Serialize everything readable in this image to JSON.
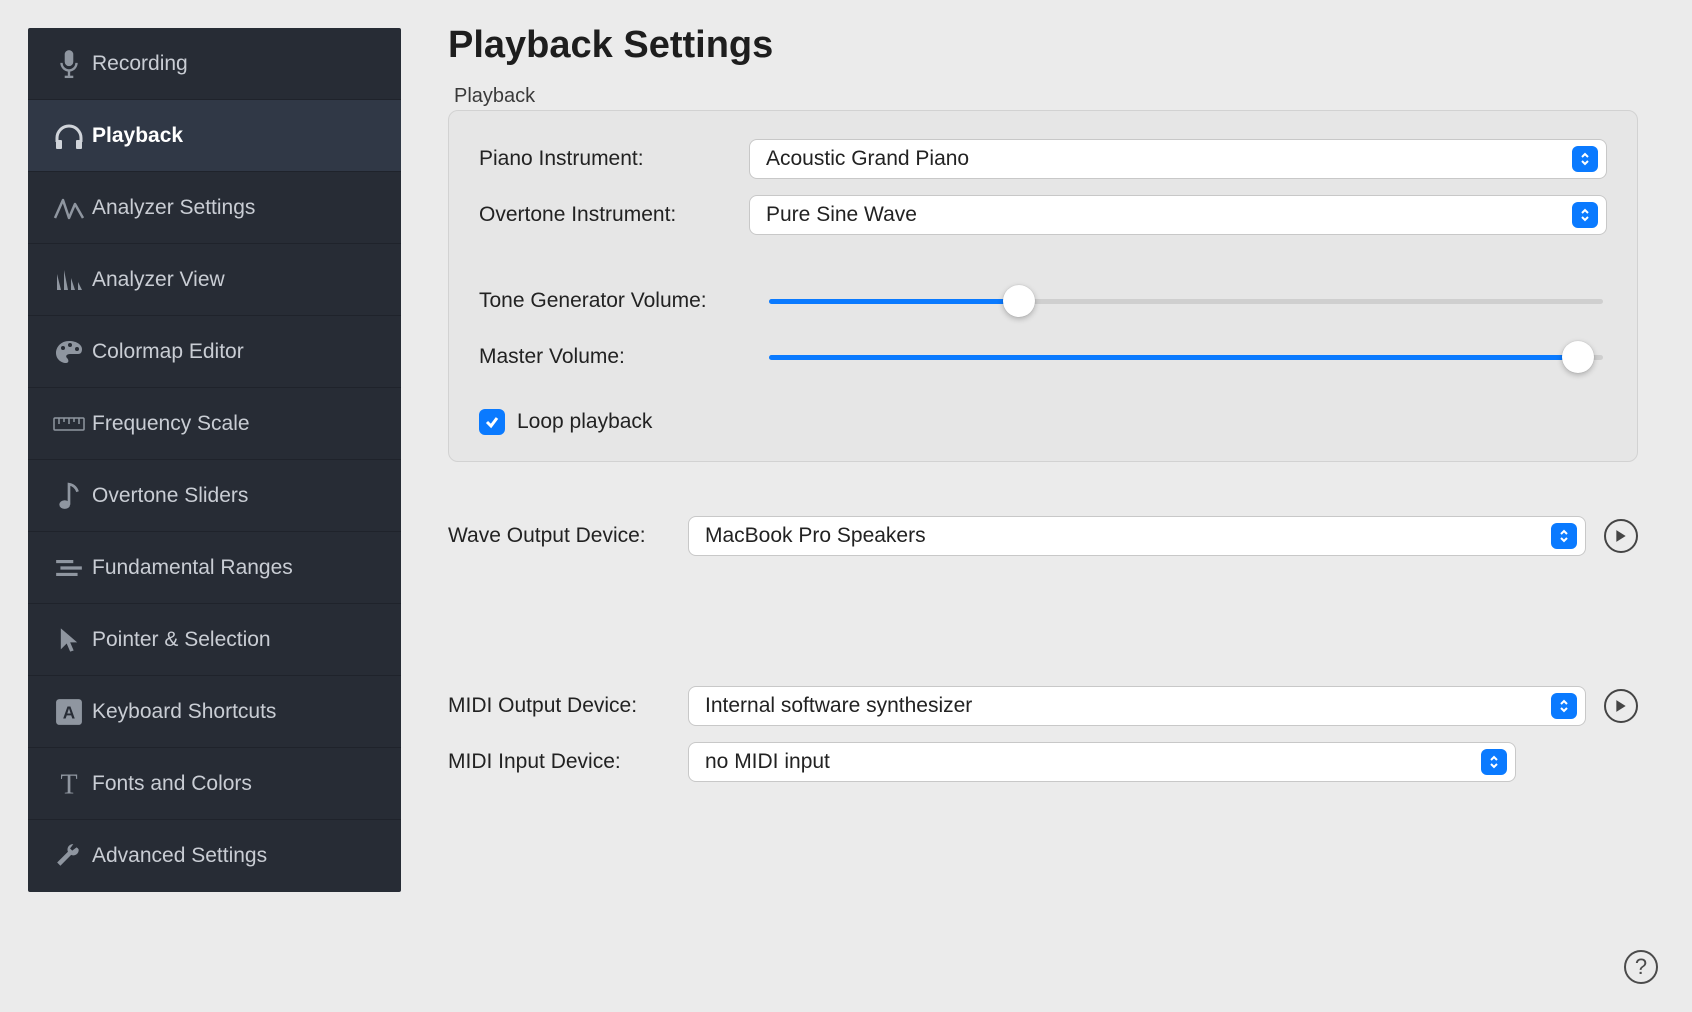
{
  "sidebar": {
    "items": [
      {
        "label": "Recording",
        "icon": "mic-icon"
      },
      {
        "label": "Playback",
        "icon": "headphones-icon"
      },
      {
        "label": "Analyzer Settings",
        "icon": "wave-icon"
      },
      {
        "label": "Analyzer View",
        "icon": "bars-icon"
      },
      {
        "label": "Colormap Editor",
        "icon": "palette-icon"
      },
      {
        "label": "Frequency Scale",
        "icon": "ruler-icon"
      },
      {
        "label": "Overtone Sliders",
        "icon": "note-icon"
      },
      {
        "label": "Fundamental Ranges",
        "icon": "lines-icon"
      },
      {
        "label": "Pointer & Selection",
        "icon": "pointer-icon"
      },
      {
        "label": "Keyboard Shortcuts",
        "icon": "key-a-icon"
      },
      {
        "label": "Fonts and Colors",
        "icon": "text-t-icon"
      },
      {
        "label": "Advanced Settings",
        "icon": "wrench-icon"
      }
    ],
    "active_index": 1
  },
  "page": {
    "title": "Playback Settings",
    "section": "Playback"
  },
  "panel": {
    "piano_label": "Piano Instrument:",
    "piano_value": "Acoustic Grand Piano",
    "overtone_label": "Overtone Instrument:",
    "overtone_value": "Pure Sine Wave",
    "tone_vol_label": "Tone Generator Volume:",
    "tone_vol_percent": 30,
    "master_vol_label": "Master Volume:",
    "master_vol_percent": 97,
    "loop_label": "Loop playback",
    "loop_checked": true
  },
  "devices": {
    "wave_out_label": "Wave Output Device:",
    "wave_out_value": "MacBook Pro Speakers",
    "midi_out_label": "MIDI Output Device:",
    "midi_out_value": "Internal software synthesizer",
    "midi_in_label": "MIDI Input Device:",
    "midi_in_value": "no MIDI input"
  }
}
